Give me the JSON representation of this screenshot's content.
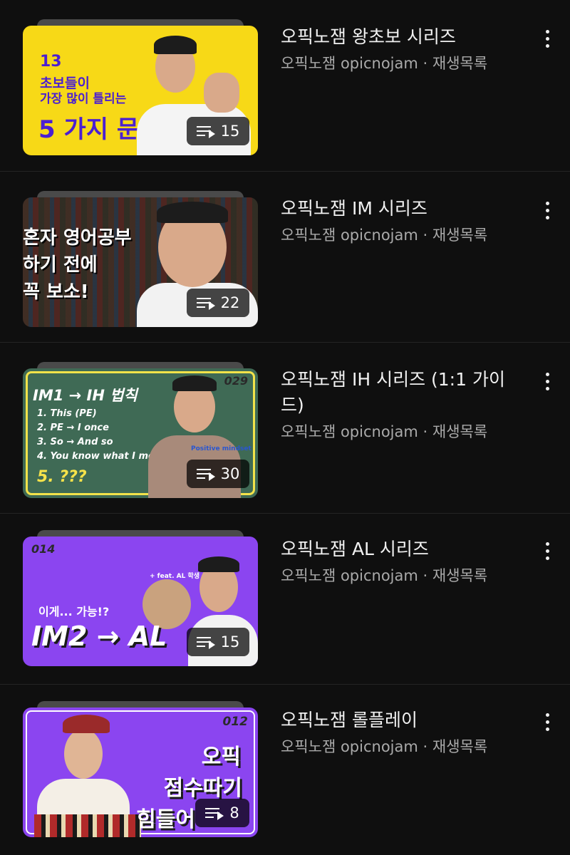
{
  "playlists": [
    {
      "title": "오픽노잼 왕초보 시리즈",
      "channel": "오픽노잼 opicnojam",
      "kind": "재생목록",
      "count": "15",
      "thumb": {
        "bg": "#f7d917",
        "number": "13",
        "line1": "초보들이",
        "line2": "가장 많이 틀리는",
        "headline": "5 가지 문법"
      }
    },
    {
      "title": "오픽노잼 IM 시리즈",
      "channel": "오픽노잼 opicnojam",
      "kind": "재생목록",
      "count": "22",
      "thumb": {
        "bg": "#2a2320",
        "line1": "혼자 영어공부",
        "line2": "하기 전에",
        "line3": "꼭 보소!"
      }
    },
    {
      "title": "오픽노잼 IH 시리즈 (1:1 가이드)",
      "channel": "오픽노잼 opicnojam",
      "kind": "재생목록",
      "count": "30",
      "thumb": {
        "bg": "#3f6a55",
        "number": "029",
        "headline": "IM1 → IH 법칙",
        "items": [
          "1. This (PE)",
          "2. PE → I once",
          "3. So → And so",
          "4. You know what I mean"
        ],
        "last": "5. ???",
        "tag": "Positive mindset"
      }
    },
    {
      "title": "오픽노잼 AL 시리즈",
      "channel": "오픽노잼 opicnojam",
      "kind": "재생목록",
      "count": "15",
      "thumb": {
        "bg": "#8b45f0",
        "number": "014",
        "note": "+ feat. AL 학생",
        "sub": "이게... 가능!?",
        "headline": "IM2 → AL"
      }
    },
    {
      "title": "오픽노잼 롤플레이",
      "channel": "오픽노잼 opicnojam",
      "kind": "재생목록",
      "count": "8",
      "thumb": {
        "bg": "#8b45f0",
        "number": "012",
        "line1": "오픽",
        "line2": "점수따기",
        "line3": "힘들어"
      }
    }
  ],
  "separator": "·"
}
